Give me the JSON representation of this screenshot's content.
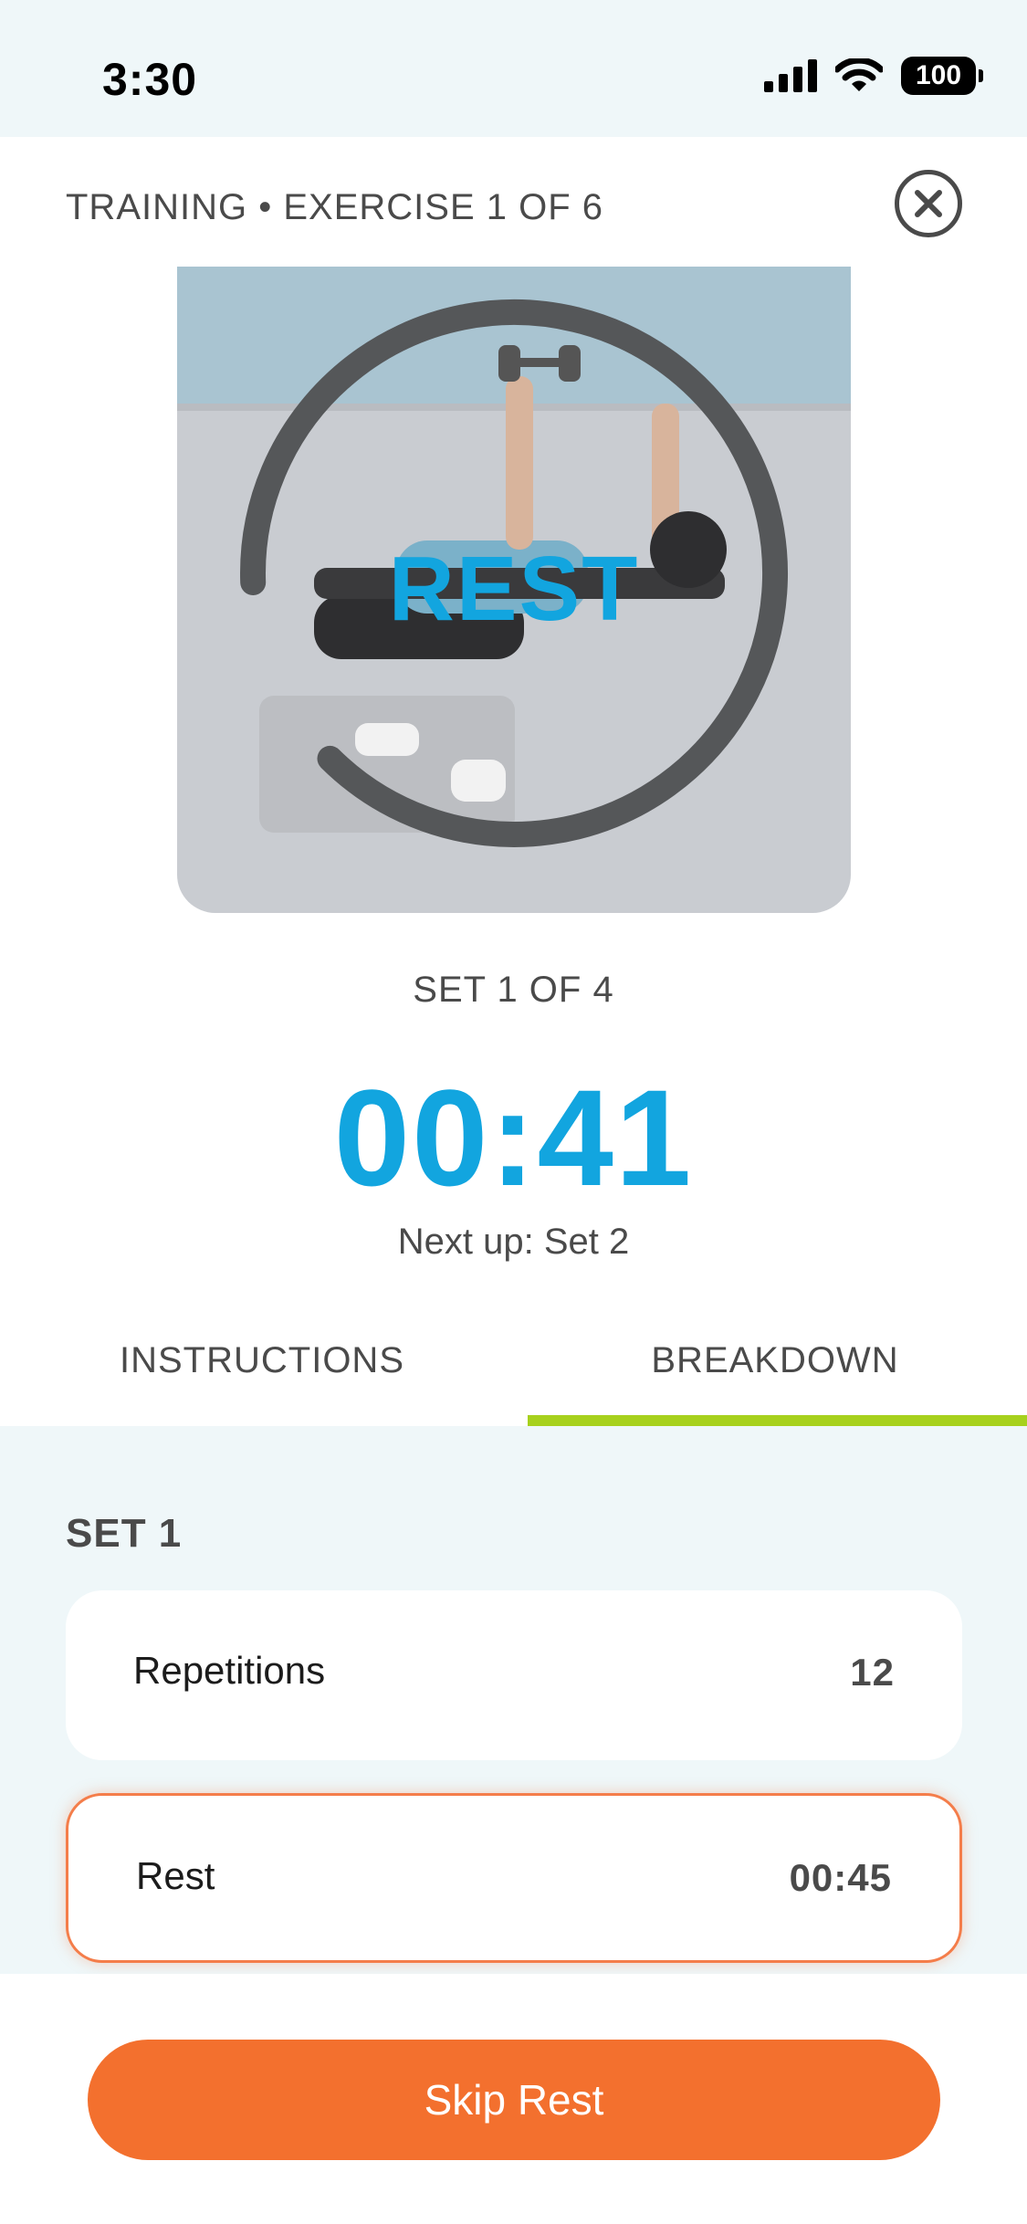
{
  "status_bar": {
    "time": "3:30",
    "battery": "100"
  },
  "header": {
    "title": "TRAINING • EXERCISE 1 OF 6"
  },
  "exercise": {
    "overlay_label": "REST",
    "rest_ring_progress": 0.88
  },
  "session": {
    "set_progress": "SET 1 OF 4",
    "timer": "00:41",
    "next_up": "Next up: Set 2"
  },
  "tabs": [
    {
      "label": "INSTRUCTIONS",
      "active": false
    },
    {
      "label": "BREAKDOWN",
      "active": true
    }
  ],
  "breakdown": {
    "set_heading": "SET 1",
    "rows": [
      {
        "label": "Repetitions",
        "value": "12"
      },
      {
        "label": "Rest",
        "value": "00:45"
      }
    ]
  },
  "footer": {
    "skip_label": "Skip Rest"
  },
  "colors": {
    "accent_blue": "#12a5df",
    "accent_orange": "#f3702e",
    "tab_underline": "#a7d11d",
    "panel_bg": "#eff7f9"
  }
}
